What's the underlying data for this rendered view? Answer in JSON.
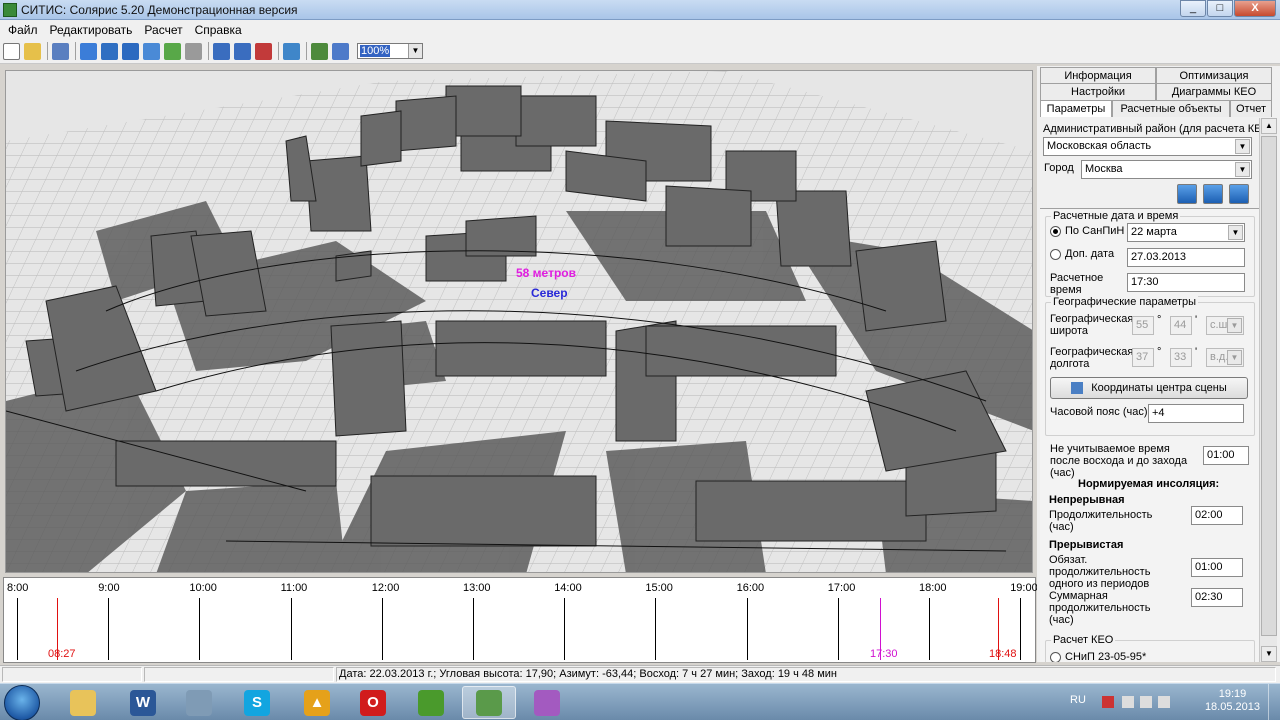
{
  "window": {
    "title": "СИТИС: Солярис 5.20 Демонстрационная версия",
    "min": "_",
    "max": "□",
    "close": "X"
  },
  "menu": [
    "Файл",
    "Редактировать",
    "Расчет",
    "Справка"
  ],
  "toolbar": {
    "zoom": "100%"
  },
  "scene": {
    "label_magenta": "58 метров",
    "label_blue": "Север"
  },
  "timeline": {
    "hours": [
      "8:00",
      "9:00",
      "10:00",
      "11:00",
      "12:00",
      "13:00",
      "14:00",
      "15:00",
      "16:00",
      "17:00",
      "18:00",
      "19:00"
    ],
    "sunrise": "08:27",
    "current": "17:30",
    "sunset": "18:48"
  },
  "tabs": {
    "row1": [
      "Информация",
      "Оптимизация"
    ],
    "row2": [
      "Настройки",
      "Диаграммы КЕО"
    ],
    "row3": [
      "Параметры",
      "Расчетные объекты",
      "Отчет"
    ]
  },
  "params": {
    "region_label": "Административный район (для расчета КЕО):",
    "region": "Московская область",
    "city_label": "Город",
    "city": "Москва",
    "dates_group": "Расчетные дата и время",
    "opt_sanpin": "По СанПиН",
    "sanpin_date": "22 марта",
    "opt_extra": "Доп. дата",
    "extra_date": "27.03.2013",
    "calc_time_label": "Расчетное время",
    "calc_time": "17:30",
    "geo_group": "Географические параметры",
    "lat_label": "Географическая широта",
    "lat_deg": "55",
    "lat_min": "44",
    "lat_dir": "с.ш.",
    "lon_label": "Географическая долгота",
    "lon_deg": "37",
    "lon_min": "33",
    "lon_dir": "в.д.",
    "deg_sign": "°",
    "min_sign": "'",
    "center_btn": "Координаты центра сцены",
    "tz_label": "Часовой пояс (час)",
    "tz": "+4",
    "ignore_label": "Не учитываемое время после восхода и до захода (час)",
    "ignore": "01:00",
    "norm_title": "Нормируемая инсоляция:",
    "cont_title": "Непрерывная",
    "cont_label": "Продолжительность (час)",
    "cont": "02:00",
    "inter_title": "Прерывистая",
    "inter_req_label": "Обязат. продолжительность одного из периодов",
    "inter_req": "01:00",
    "inter_sum_label": "Суммарная продолжительность (час)",
    "inter_sum": "02:30",
    "keo_group": "Расчет КЕО",
    "keo_opt": "СНиП 23-05-95*"
  },
  "status": "Дата: 22.03.2013 г.; Угловая высота: 17,90; Азимут: -63,44; Восход: 7 ч 27 мин; Заход: 19 ч 48 мин",
  "taskbar": {
    "apps": [
      {
        "name": "explorer-icon",
        "glyph": "",
        "color": "#e8c35a"
      },
      {
        "name": "word-icon",
        "glyph": "W",
        "color": "#2b5797"
      },
      {
        "name": "calculator-icon",
        "glyph": "",
        "color": "#7f9bb5"
      },
      {
        "name": "skype-icon",
        "glyph": "S",
        "color": "#12a5e0"
      },
      {
        "name": "triangle-app-icon",
        "glyph": "▲",
        "color": "#e5a11a"
      },
      {
        "name": "opera-icon",
        "glyph": "O",
        "color": "#d11c1c"
      },
      {
        "name": "chrome-icon",
        "glyph": "",
        "color": "#4a9a2c"
      },
      {
        "name": "solaris-icon",
        "glyph": "",
        "color": "#5a9a4a"
      },
      {
        "name": "picasa-icon",
        "glyph": "",
        "color": "#a35ac0"
      }
    ],
    "lang": "RU",
    "time": "19:19",
    "date": "18.05.2013"
  }
}
